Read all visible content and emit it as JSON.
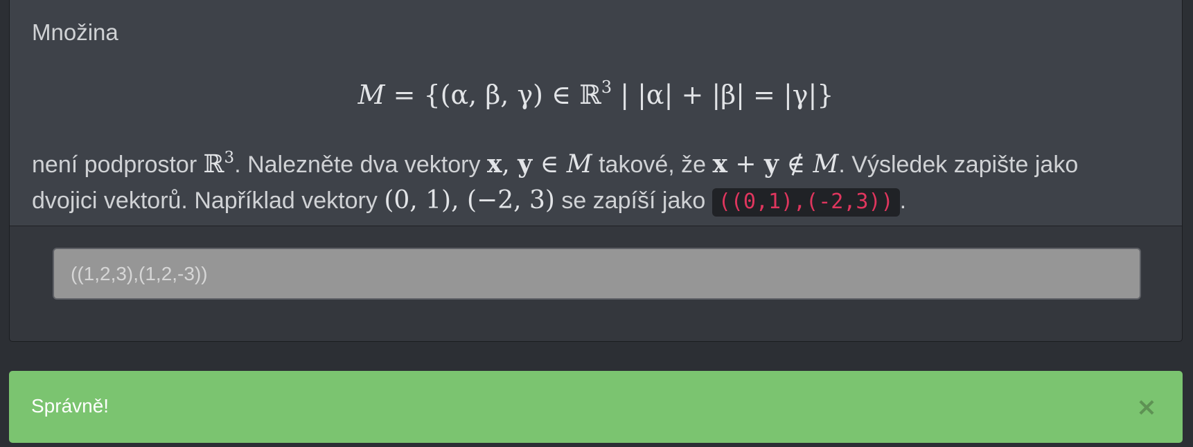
{
  "problem": {
    "intro": "Množina",
    "set_lhs": "M",
    "set_rhs": "= {(α, β, γ) ∈ ℝ",
    "set_exp": "3",
    "set_cond": " | |α| + |β| = |γ|}",
    "line1_a": "není podprostor ",
    "space": "ℝ",
    "space_exp": "3",
    "line1_b": ". Nalezněte dva vektory ",
    "vec_x": "x",
    "vec_y": "y",
    "comma": ", ",
    "in": " ∈ ",
    "set_name": "M",
    "line1_c": " takové, že ",
    "plus": " + ",
    "notin": " ∉ ",
    "line1_d": ". Výsledek zapište jako",
    "line2_a": "dvojici vektorů. Například vektory ",
    "example_math": "(0, 1), (−2, 3)",
    "line2_b": " se zapíší jako ",
    "example_code": "((0,1),(-2,3))",
    "line2_c": "."
  },
  "answer": {
    "value": "((1,2,3),(1,2,-3))"
  },
  "alert": {
    "message": "Správně!",
    "close_label": "×"
  }
}
